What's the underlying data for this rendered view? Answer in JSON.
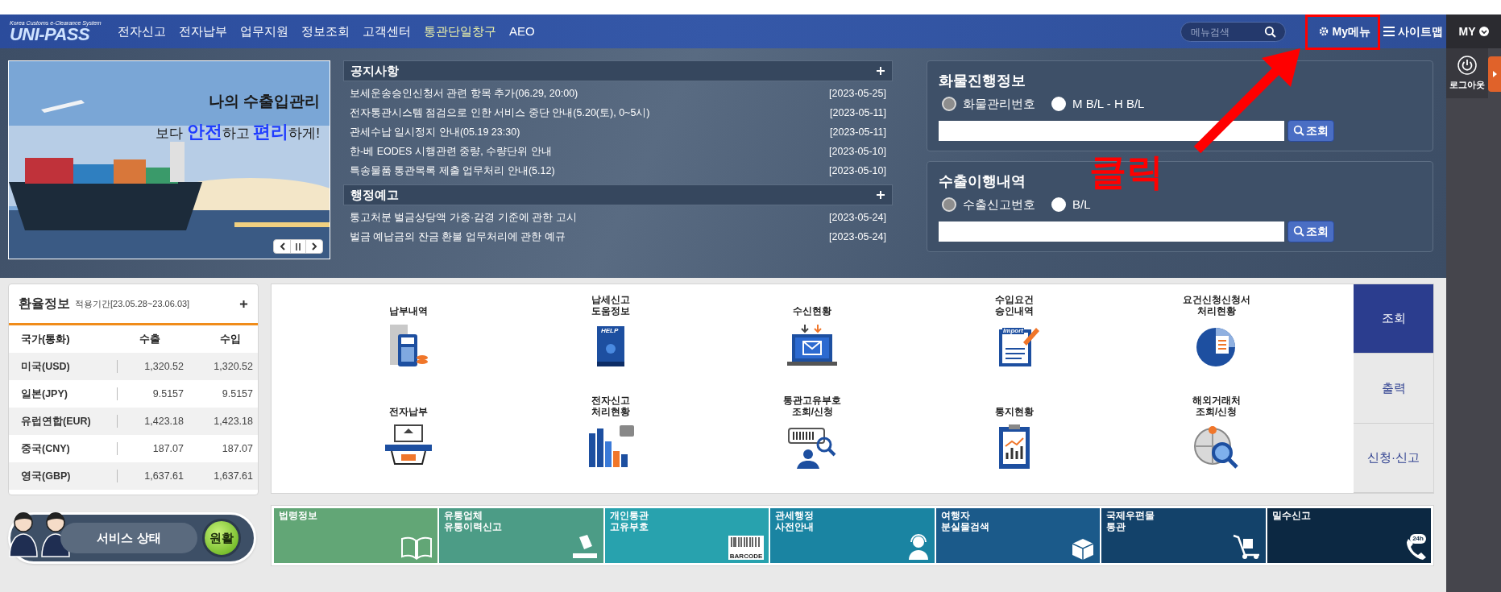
{
  "header": {
    "logo_tagline": "Korea Customs e-Clearance System",
    "logo": "UNI-PASS",
    "nav": [
      "전자신고",
      "전자납부",
      "업무지원",
      "정보조회",
      "고객센터",
      "통관단일창구",
      "AEO"
    ],
    "search": {
      "placeholder": "메뉴검색"
    },
    "my_menu": "My메뉴",
    "sitemap": "사이트맵"
  },
  "side_panel": {
    "title": "MY",
    "logout": "로그아웃"
  },
  "banner": {
    "line1": "나의 수출입관리",
    "line2": "보다 **안전**하고 **편리**하게!"
  },
  "notices": {
    "title": "공지사항",
    "items": [
      {
        "text": "보세운송승인신청서 관련 항목 추가(06.29, 20:00)",
        "date": "[2023-05-25]"
      },
      {
        "text": "전자통관시스템 점검으로 인한 서비스 중단 안내(5.20(토), 0~5시)",
        "date": "[2023-05-11]"
      },
      {
        "text": "관세수납 일시정지 안내(05.19 23:30)",
        "date": "[2023-05-11]"
      },
      {
        "text": "한-베 EODES 시행관련 중량, 수량단위 안내",
        "date": "[2023-05-10]"
      },
      {
        "text": "특송물품 통관목록 제출 업무처리 안내(5.12)",
        "date": "[2023-05-10]"
      }
    ]
  },
  "admin_notices": {
    "title": "행정예고",
    "items": [
      {
        "text": "통고처분 벌금상당액 가중·감경 기준에 관한 고시",
        "date": "[2023-05-24]"
      },
      {
        "text": "벌금 예납금의 잔금 환불 업무처리에 관한 예규",
        "date": "[2023-05-24]"
      }
    ]
  },
  "cargo_progress": {
    "title": "화물진행정보",
    "options": [
      {
        "label": "화물관리번호",
        "selected": true
      },
      {
        "label": "M B/L - H B/L",
        "selected": false
      }
    ],
    "button": "조회"
  },
  "export_history": {
    "title": "수출이행내역",
    "options": [
      {
        "label": "수출신고번호",
        "selected": true
      },
      {
        "label": "B/L",
        "selected": false
      }
    ],
    "button": "조회"
  },
  "annotation": {
    "text": "클릭"
  },
  "exchange": {
    "title": "환율정보",
    "period": "적용기간[23.05.28~23.06.03]",
    "columns": [
      "국가(통화)",
      "수출",
      "수입"
    ],
    "rows": [
      {
        "country": "미국(USD)",
        "export": "1,320.52",
        "import": "1,320.52"
      },
      {
        "country": "일본(JPY)",
        "export": "9.5157",
        "import": "9.5157"
      },
      {
        "country": "유럽연합(EUR)",
        "export": "1,423.18",
        "import": "1,423.18"
      },
      {
        "country": "중국(CNY)",
        "export": "187.07",
        "import": "187.07"
      },
      {
        "country": "영국(GBP)",
        "export": "1,637.61",
        "import": "1,637.61"
      }
    ]
  },
  "services": {
    "items": [
      {
        "label": "납부내역"
      },
      {
        "label": "납세신고\n도움정보",
        "icon_text": "HELP"
      },
      {
        "label": "수신현황"
      },
      {
        "label": "수입요건\n승인내역",
        "icon_text": "Import"
      },
      {
        "label": "요건신청신청서\n처리현황"
      },
      {
        "label": "전자납부"
      },
      {
        "label": "전자신고\n처리현황"
      },
      {
        "label": "통관고유부호\n조회/신청"
      },
      {
        "label": "통지현황"
      },
      {
        "label": "해외거래처\n조회/신청"
      }
    ],
    "tabs": [
      {
        "label": "조회",
        "selected": true
      },
      {
        "label": "출력",
        "selected": false
      },
      {
        "label": "신청·신고",
        "selected": false
      }
    ]
  },
  "service_status": {
    "label": "서비스 상태",
    "status": "원활"
  },
  "quick_links": [
    {
      "label": "법령정보",
      "color": "#62a676"
    },
    {
      "label": "유통업체\n유통이력신고",
      "color": "#4c9c86"
    },
    {
      "label": "개인통관\n고유부호",
      "color": "#28a2ae",
      "icon_text": "BARCODE"
    },
    {
      "label": "관세행정\n사전안내",
      "color": "#1a84a2"
    },
    {
      "label": "여행자\n분실물검색",
      "color": "#1b5a8a"
    },
    {
      "label": "국제우편물\n통관",
      "color": "#13426a"
    },
    {
      "label": "밀수신고",
      "color": "#0c2842",
      "icon_text": "24h"
    }
  ]
}
